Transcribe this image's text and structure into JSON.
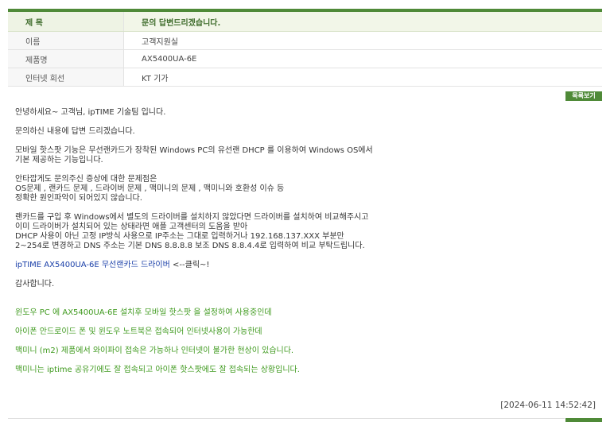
{
  "info": {
    "subject_label": "제 목",
    "subject_value": "문의 답변드리겠습니다.",
    "name_label": "이름",
    "name_value": "고객지원실",
    "product_label": "제품명",
    "product_value": "AX5400UA-6E",
    "internet_label": "인터넷 회선",
    "internet_value": "KT 기가"
  },
  "list_button": "목록보기",
  "answer": {
    "greeting": "안녕하세요~ 고객님, ipTIME 기술팀 입니다.",
    "intro": "문의하신 내용에 답변 드리겠습니다.",
    "p1_l1": "모바일 핫스팟 기능은 무선랜카드가 장착된 Windows PC의 유선랜 DHCP 를 이용하여 Windows OS에서",
    "p1_l2": "기본 제공하는 기능입니다.",
    "p2_l1": "안타깝게도 문의주신 증상에 대한 문제점은",
    "p2_l2": "OS문제 , 랜카드 문제 , 드라이버 문제 , 맥미니의 문제 , 맥미니와 호환성 이슈 등",
    "p2_l3": "정확한 원인파악이 되어있지 않습니다.",
    "p3_l1": "랜카드를 구입 후 Windows에서 별도의 드라이버를 설치하지 않았다면 드라이버를 설치하여 비교해주시고",
    "p3_l2": "이미 드라이버가 설치되어 있는 상태라면 애플 고객센터의 도움을 받아",
    "p3_l3": "DHCP 사용이 아닌 고정 IP방식 사용으로 IP주소는 그대로 입력하거나 192.168.137.XXX 부분만",
    "p3_l4": "2~254로 변경하고 DNS 주소는 기본 DNS 8.8.8.8 보조 DNS 8.8.4.4로 입력하여 비교 부탁드립니다.",
    "driver_link": "ipTIME AX5400UA-6E 무선랜카드 드라이버",
    "click_hint": " <--클릭~!",
    "thanks": "감사합니다."
  },
  "question": {
    "q1": "윈도우 PC 에 AX5400UA-6E 설치후 모바일 핫스팟 을 설정하여 사용중인데",
    "q2": "아이폰 안드로이드 폰 및 윈도우 노트북은 접속되어 인터넷사용이 가능한데",
    "q3": "맥미니 (m2) 제품에서 와이파이 접속은 가능하나 인터넷이 불가한 현상이 있습니다.",
    "q4": "맥미니는 iptime 공유기에도 잘 접속되고 아이폰 핫스팟에도 잘 접속되는 상황입니다."
  },
  "timestamp": "[2024-06-11 14:52:42]",
  "colors": {
    "accent_green": "#4f8a38",
    "question_text_green": "#3f9a1e",
    "link_blue": "#1a3fa8"
  }
}
